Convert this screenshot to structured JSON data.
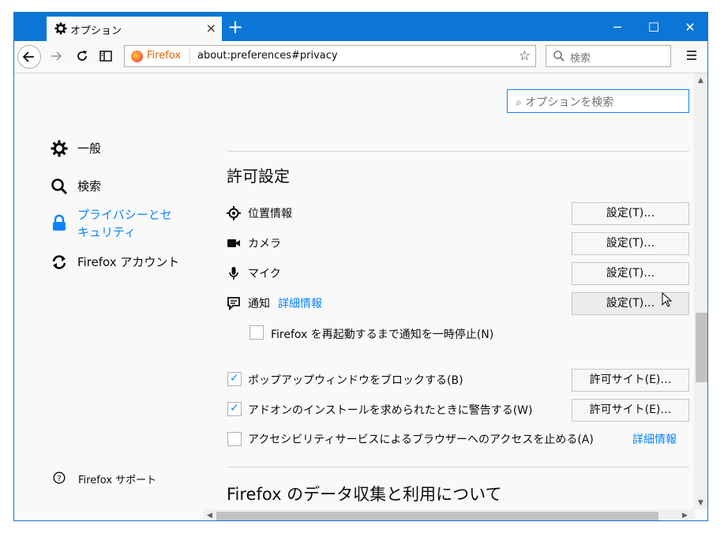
{
  "tab": {
    "title": "オプション",
    "close": "×"
  },
  "new_tab": "+",
  "window_controls": {
    "minimize": "─",
    "maximize": "☐",
    "close": "✕"
  },
  "urlbar": {
    "identity": "Firefox",
    "url": "about:preferences#privacy"
  },
  "searchbar": {
    "placeholder": "検索"
  },
  "find": {
    "placeholder": "オプションを検索"
  },
  "sidebar": {
    "items": [
      {
        "label": "一般",
        "icon": "gear-icon"
      },
      {
        "label": "検索",
        "icon": "search-icon"
      },
      {
        "label": "プライバシーとセ",
        "label2": "キュリティ",
        "icon": "lock-icon"
      },
      {
        "label": "Firefox アカウント",
        "icon": "sync-icon"
      }
    ],
    "support": "Firefox サポート"
  },
  "permissions": {
    "heading": "許可設定",
    "location": "位置情報",
    "camera": "カメラ",
    "microphone": "マイク",
    "notifications": "通知",
    "notifications_link": "詳細情報",
    "settings_button": "設定(T)…",
    "pause_notifications": "Firefox を再起動するまで通知を一時停止(N)",
    "block_popups": "ポップアップウィンドウをブロックする(B)",
    "warn_addons": "アドオンのインストールを求められたときに警告する(W)",
    "exceptions_e": "許可サイト(E)…",
    "a11y": "アクセシビリティサービスによるブラウザーへのアクセスを止める(A)",
    "a11y_link": "詳細情報"
  },
  "data_collection": {
    "heading": "Firefox のデータ収集と利用について"
  },
  "state": {
    "pause_notifications_checked": false,
    "block_popups_checked": true,
    "warn_addons_checked": true,
    "a11y_checked": false
  },
  "colors": {
    "accent": "#0a84ff",
    "titlebar": "#0b76d6",
    "identity": "#e66000"
  }
}
